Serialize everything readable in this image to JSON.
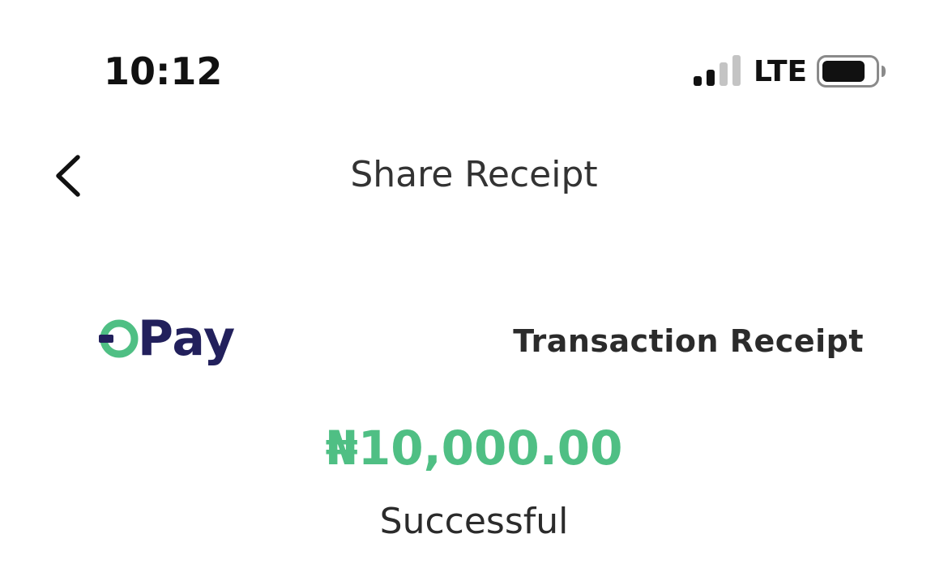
{
  "status_bar": {
    "time": "10:12",
    "network": "LTE",
    "signal_bars_active": 2,
    "signal_bars_total": 4
  },
  "nav": {
    "title": "Share Receipt",
    "back_icon": "chevron-left-icon"
  },
  "receipt": {
    "brand": "Pay",
    "title": "Transaction Receipt",
    "amount": "₦10,000.00",
    "status": "Successful"
  },
  "colors": {
    "brand_green": "#4fbf84",
    "brand_navy": "#22205c",
    "text_dark": "#2b2b2b"
  }
}
